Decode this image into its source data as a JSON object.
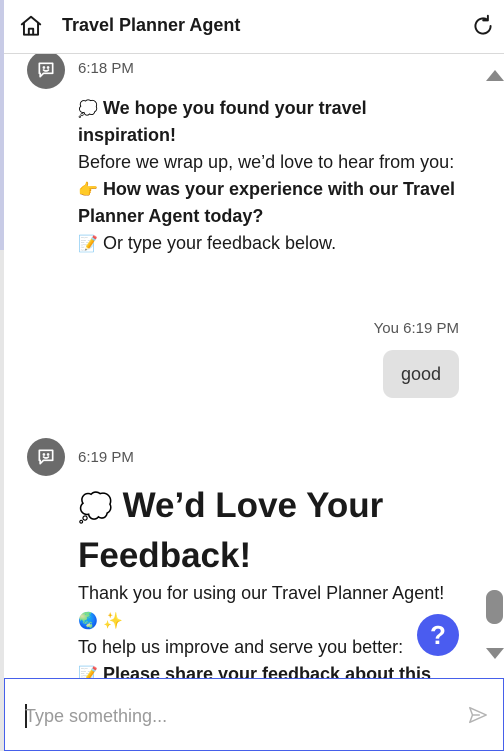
{
  "header": {
    "title": "Travel Planner Agent",
    "home_icon": "home-icon",
    "refresh_icon": "refresh-icon"
  },
  "messages": [
    {
      "sender": "agent",
      "time": "6:18 PM",
      "line1": "We hope you found your travel inspiration!",
      "line1_emoji": "💭",
      "line2": "Before we wrap up, we’d love to hear from you:",
      "line3": "How was your experience with our Travel Planner Agent today?",
      "line3_emoji": "👉",
      "line4": "Or type your feedback below.",
      "line4_emoji": "📝"
    },
    {
      "sender": "user",
      "label": "You 6:19 PM",
      "text": "good"
    },
    {
      "sender": "agent",
      "time": "6:19 PM",
      "heading": "We’d Love Your Feedback!",
      "heading_emoji": "💭",
      "line1": "Thank you for using our Travel Planner Agent!",
      "line1_emoji": "🌏 ✨",
      "line2": "To help us improve and serve you better:",
      "line3": "Please share your feedback about this",
      "line3_emoji": "📝"
    }
  ],
  "help_button": {
    "label": "?"
  },
  "composer": {
    "placeholder": "Type something...",
    "value": ""
  },
  "colors": {
    "accent": "#4a5cf0",
    "composer_border": "#4660ea",
    "avatar": "#6b6b6b",
    "user_bubble": "#e1e1e1"
  }
}
